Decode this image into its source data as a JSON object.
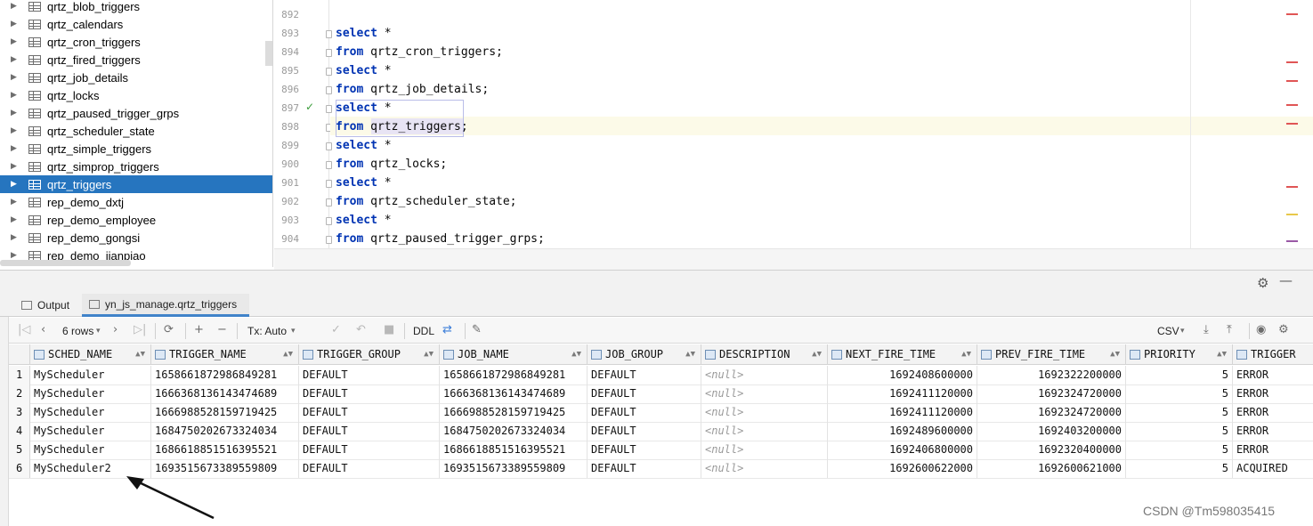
{
  "tree": {
    "items": [
      {
        "label": "qrtz_blob_triggers",
        "selected": false
      },
      {
        "label": "qrtz_calendars",
        "selected": false
      },
      {
        "label": "qrtz_cron_triggers",
        "selected": false
      },
      {
        "label": "qrtz_fired_triggers",
        "selected": false
      },
      {
        "label": "qrtz_job_details",
        "selected": false
      },
      {
        "label": "qrtz_locks",
        "selected": false
      },
      {
        "label": "qrtz_paused_trigger_grps",
        "selected": false
      },
      {
        "label": "qrtz_scheduler_state",
        "selected": false
      },
      {
        "label": "qrtz_simple_triggers",
        "selected": false
      },
      {
        "label": "qrtz_simprop_triggers",
        "selected": false
      },
      {
        "label": "qrtz_triggers",
        "selected": true
      },
      {
        "label": "rep_demo_dxtj",
        "selected": false
      },
      {
        "label": "rep_demo_employee",
        "selected": false
      },
      {
        "label": "rep_demo_gongsi",
        "selected": false
      },
      {
        "label": "rep_demo_jianpiao",
        "selected": false
      }
    ]
  },
  "editor": {
    "lines": [
      {
        "num": "892",
        "kw": "",
        "rest": ""
      },
      {
        "num": "893",
        "kw": "select",
        "rest": " *"
      },
      {
        "num": "894",
        "kw": "from",
        "rest": " qrtz_cron_triggers;"
      },
      {
        "num": "895",
        "kw": "select",
        "rest": " *"
      },
      {
        "num": "896",
        "kw": "from",
        "rest": " qrtz_job_details;"
      },
      {
        "num": "897",
        "kw": "select",
        "rest": " *"
      },
      {
        "num": "898",
        "kw": "from",
        "rest": " qrtz_triggers;"
      },
      {
        "num": "899",
        "kw": "select",
        "rest": " *"
      },
      {
        "num": "900",
        "kw": "from",
        "rest": " qrtz_locks;"
      },
      {
        "num": "901",
        "kw": "select",
        "rest": " *"
      },
      {
        "num": "902",
        "kw": "from",
        "rest": " qrtz_scheduler_state;"
      },
      {
        "num": "903",
        "kw": "select",
        "rest": " *"
      },
      {
        "num": "904",
        "kw": "from",
        "rest": " qrtz_paused_trigger_grps;"
      }
    ],
    "executed_line": "897"
  },
  "panel": {
    "tabs": [
      {
        "label": "Output",
        "active": false
      },
      {
        "label": "yn_js_manage.qrtz_triggers",
        "active": true
      }
    ]
  },
  "toolbar": {
    "rows_label": "6 rows",
    "tx_label": "Tx: Auto",
    "ddl_label": "DDL",
    "format_label": "CSV"
  },
  "grid": {
    "columns": [
      "SCHED_NAME",
      "TRIGGER_NAME",
      "TRIGGER_GROUP",
      "JOB_NAME",
      "JOB_GROUP",
      "DESCRIPTION",
      "NEXT_FIRE_TIME",
      "PREV_FIRE_TIME",
      "PRIORITY",
      "TRIGGER"
    ],
    "rows": [
      {
        "n": "1",
        "cells": [
          "MyScheduler",
          "1658661872986849281",
          "DEFAULT",
          "1658661872986849281",
          "DEFAULT",
          "<null>",
          "1692408600000",
          "1692322200000",
          "5",
          "ERROR"
        ]
      },
      {
        "n": "2",
        "cells": [
          "MyScheduler",
          "1666368136143474689",
          "DEFAULT",
          "1666368136143474689",
          "DEFAULT",
          "<null>",
          "1692411120000",
          "1692324720000",
          "5",
          "ERROR"
        ]
      },
      {
        "n": "3",
        "cells": [
          "MyScheduler",
          "1666988528159719425",
          "DEFAULT",
          "1666988528159719425",
          "DEFAULT",
          "<null>",
          "1692411120000",
          "1692324720000",
          "5",
          "ERROR"
        ]
      },
      {
        "n": "4",
        "cells": [
          "MyScheduler",
          "1684750202673324034",
          "DEFAULT",
          "1684750202673324034",
          "DEFAULT",
          "<null>",
          "1692489600000",
          "1692403200000",
          "5",
          "ERROR"
        ]
      },
      {
        "n": "5",
        "cells": [
          "MyScheduler",
          "1686618851516395521",
          "DEFAULT",
          "1686618851516395521",
          "DEFAULT",
          "<null>",
          "1692406800000",
          "1692320400000",
          "5",
          "ERROR"
        ]
      },
      {
        "n": "6",
        "cells": [
          "MyScheduler2",
          "1693515673389559809",
          "DEFAULT",
          "1693515673389559809",
          "DEFAULT",
          "<null>",
          "1692600622000",
          "1692600621000",
          "5",
          "ACQUIRED"
        ]
      }
    ]
  },
  "watermark": "CSDN @Tm598035415",
  "colors": {
    "selection": "#2675bf",
    "keyword": "#0033b3",
    "error_mark": "#e05555"
  }
}
